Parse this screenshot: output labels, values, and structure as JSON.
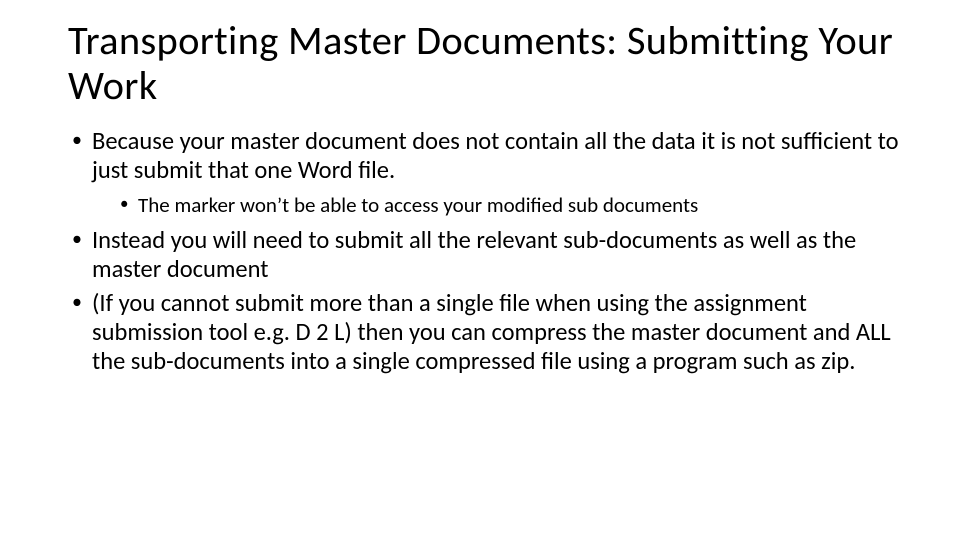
{
  "title": "Transporting Master Documents: Submitting Your Work",
  "bullets": {
    "b1": "Because your master document does not contain all the data it is not sufficient to just submit that one Word file.",
    "b1_1": "The marker won’t be able to access your modified sub documents",
    "b2": "Instead you will need to submit all the relevant sub-documents as well as the master document",
    "b3": "(If you cannot submit more than a single file when using the assignment submission tool e.g. D 2 L) then you can compress the master document and ALL the sub-documents into a single compressed file using a program such as zip."
  }
}
